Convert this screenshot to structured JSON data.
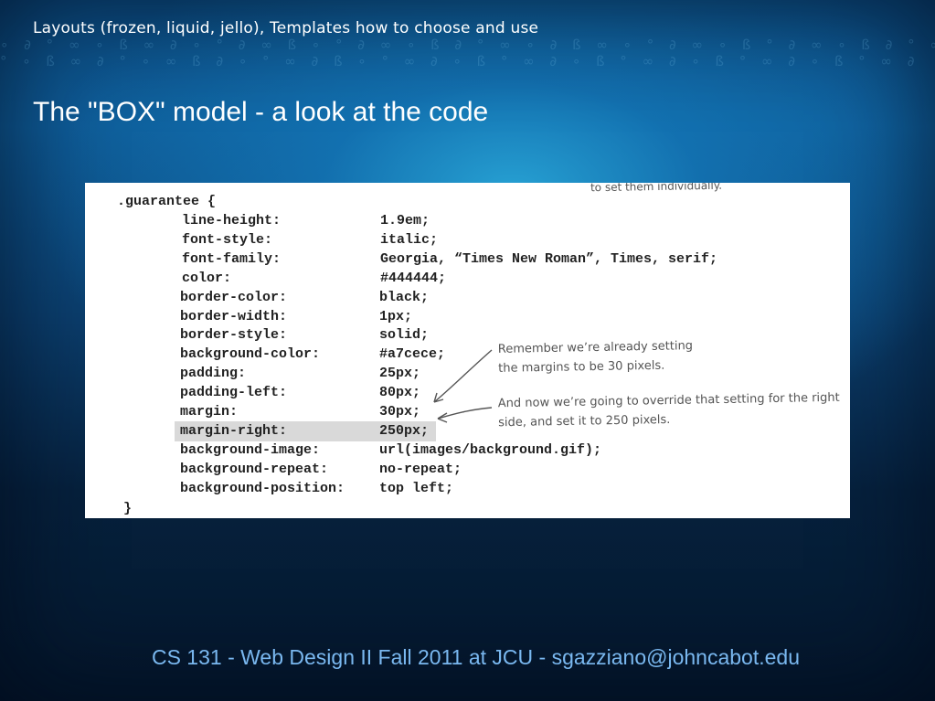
{
  "slide": {
    "header": "Layouts (frozen, liquid, jello), Templates how to choose and use",
    "title": "The \"BOX\" model - a look at the code",
    "footer": "CS 131 - Web Design II Fall 2011 at JCU - sgazziano@johncabot.edu"
  },
  "code": {
    "selector": ".guarantee {",
    "close": "}",
    "rules": [
      {
        "prop": "line-height:",
        "val": "1.9em;"
      },
      {
        "prop": "font-style:",
        "val": "italic;"
      },
      {
        "prop": "font-family:",
        "val": "Georgia, “Times New Roman”, Times, serif;"
      },
      {
        "prop": "color:",
        "val": "#444444;"
      },
      {
        "prop": "border-color:",
        "val": "black;"
      },
      {
        "prop": "border-width:",
        "val": "1px;"
      },
      {
        "prop": "border-style:",
        "val": "solid;"
      },
      {
        "prop": "background-color:",
        "val": "#a7cece;"
      },
      {
        "prop": "padding:",
        "val": "25px;"
      },
      {
        "prop": "padding-left:",
        "val": "80px;"
      },
      {
        "prop": "margin:",
        "val": "30px;"
      },
      {
        "prop": "margin-right:",
        "val": "250px;"
      },
      {
        "prop": "background-image:",
        "val": "url(images/background.gif);"
      },
      {
        "prop": "background-repeat:",
        "val": "no-repeat;"
      },
      {
        "prop": "background-position:",
        "val": "top left;"
      }
    ]
  },
  "annotations": {
    "top_partial": "to set them individually.",
    "margin_note_1": "Remember we’re already setting",
    "margin_note_2": "the margins to be 30 pixels.",
    "override_note_1": "And now we’re going to override that setting for the right",
    "override_note_2": "side, and set it to 250 pixels."
  }
}
